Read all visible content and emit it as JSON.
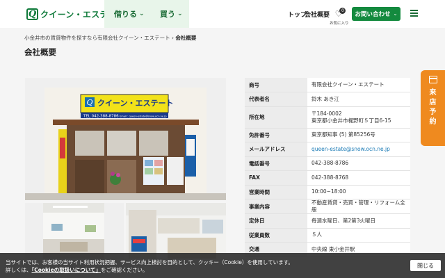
{
  "header": {
    "logo_text": "クイーン・エステート",
    "nav": {
      "borrow_label": "借りる",
      "buy_label": "買う"
    },
    "top_link": "トップ",
    "company_link": "会社概要",
    "favorites": {
      "label": "お気に入り",
      "count": "0"
    },
    "contact_label": "お問い合わせ"
  },
  "breadcrumb": {
    "parent": "小金井市の賃貸物件を探すなら有限会社クイーン・エステート",
    "separator": "›",
    "current": "会社概要"
  },
  "page_title": "会社概要",
  "storefront_sign": {
    "name": "クイーン・エステート",
    "tel": "TEL 042-388-8786",
    "email": "Email : queen-estate@snow.ocn.ne.jp"
  },
  "company_info": [
    {
      "key": "商号",
      "value": "有限会社クイーン・エステート"
    },
    {
      "key": "代表者名",
      "value": "鈴木 あき江"
    },
    {
      "key": "所在地",
      "value": "〒184-0002",
      "value2": "東京都小金井市梶野町５丁目6-15"
    },
    {
      "key": "免許番号",
      "value": "東京都知事 (5) 第85256号"
    },
    {
      "key": "メールアドレス",
      "value": "queen-estate@snow.ocn.ne.jp"
    },
    {
      "key": "電話番号",
      "value": "042-388-8786"
    },
    {
      "key": "FAX",
      "value": "042-388-8768"
    },
    {
      "key": "営業時間",
      "value": "10:00~18:00"
    },
    {
      "key": "事業内容",
      "value": "不動産賃貸・売買・管理・リフォーム全般"
    },
    {
      "key": "定休日",
      "value": "毎週水曜日、第2第3火曜日"
    },
    {
      "key": "従業員数",
      "value": "５人"
    },
    {
      "key": "交通",
      "value": "中央線 東小金井駅"
    }
  ],
  "side_tab": {
    "chars": [
      "来",
      "店",
      "予",
      "約"
    ]
  },
  "cookie": {
    "line1": "当サイトでは、お客様の当サイト利用状況把握、サービス向上検討を目的として、クッキー（Cookie）を使用しています。",
    "line2_prefix": "詳しくは、",
    "line2_link": "「Cookieの取扱いについて」",
    "line2_suffix": "をご確認ください。",
    "close_label": "閉じる"
  },
  "colors": {
    "brand_green": "#138a3e",
    "nav_bg": "#e8f5ea",
    "side_tab_orange": "#ef8a1f",
    "link_blue": "#1a7ab5"
  }
}
